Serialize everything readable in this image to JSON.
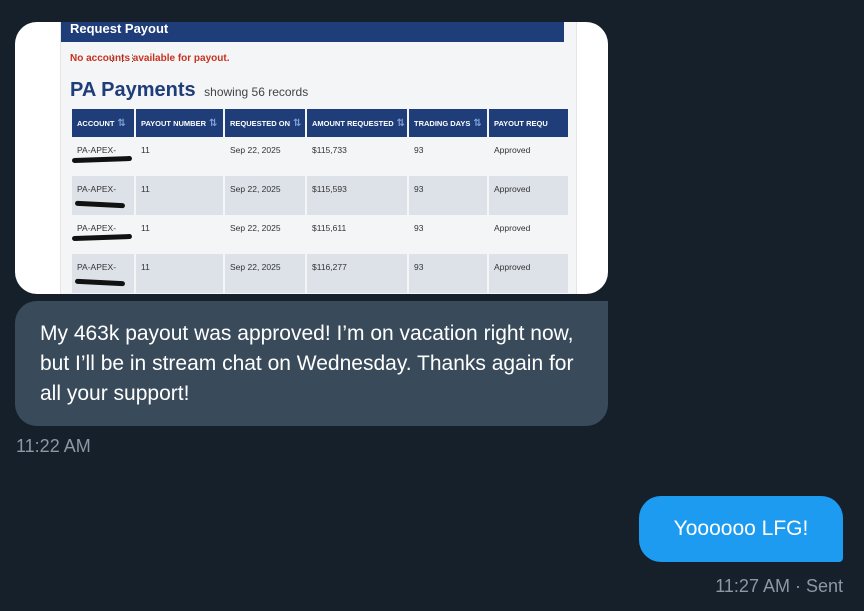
{
  "attachment": {
    "request_payout_header": "Request Payout",
    "no_accounts_msg": "No accounts available for payout.",
    "section_title": "PA Payments",
    "section_count": "showing 56 records",
    "columns": [
      "ACCOUNT",
      "PAYOUT NUMBER",
      "REQUESTED ON",
      "AMOUNT REQUESTED",
      "TRADING DAYS",
      "PAYOUT REQU"
    ],
    "rows": [
      {
        "account": "PA-APEX-",
        "payout_number": "11",
        "requested_on": "Sep 22, 2025",
        "amount": "$115,733",
        "trading_days": "93",
        "status": "Approved"
      },
      {
        "account": "PA-APEX-",
        "payout_number": "11",
        "requested_on": "Sep 22, 2025",
        "amount": "$115,593",
        "trading_days": "93",
        "status": "Approved"
      },
      {
        "account": "PA-APEX-",
        "payout_number": "11",
        "requested_on": "Sep 22, 2025",
        "amount": "$115,611",
        "trading_days": "93",
        "status": "Approved"
      },
      {
        "account": "PA-APEX-",
        "payout_number": "11",
        "requested_on": "Sep 22, 2025",
        "amount": "$116,277",
        "trading_days": "93",
        "status": "Approved"
      }
    ]
  },
  "incoming_message": {
    "text": "My 463k payout was approved! I’m on vacation right now, but I’ll be in stream chat on Wednesday. Thanks again for all your support!",
    "time": "11:22 AM"
  },
  "outgoing_message": {
    "text": "Yoooooo LFG!",
    "time": "11:27 AM · Sent"
  },
  "colors": {
    "background": "#15202b",
    "incoming_bubble": "#394b5b",
    "outgoing_bubble": "#1d9bf0",
    "header_navy": "#1f3d78"
  }
}
